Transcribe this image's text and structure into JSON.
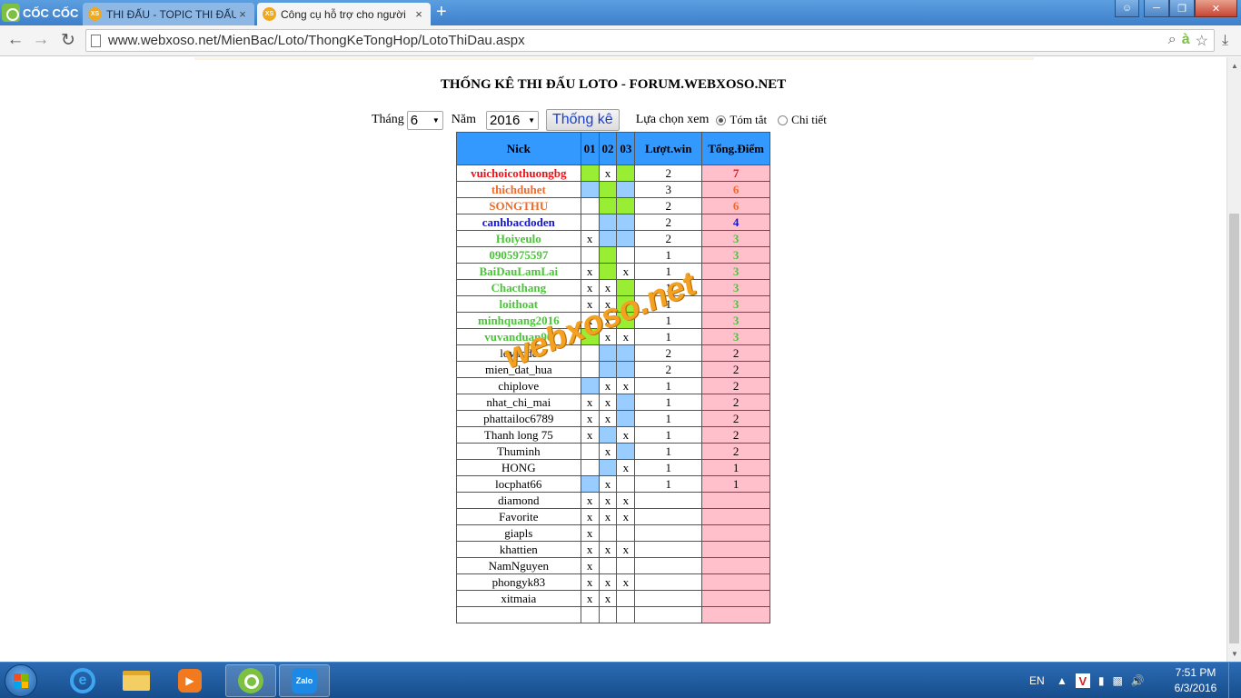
{
  "browser": {
    "brand": "CỐC CỐC",
    "tabs": [
      {
        "title": "THI ĐẤU - TOPIC THI ĐẤU",
        "favicon": "XS",
        "active": false
      },
      {
        "title": "Công cụ hỗ trợ cho người",
        "favicon": "XS",
        "active": true
      }
    ],
    "new_tab": "+",
    "url": "www.webxoso.net/MienBac/Loto/ThongKeTongHop/LotoThiDau.aspx"
  },
  "page": {
    "title": "THỐNG KÊ THI ĐẤU LOTO - FORUM.WEBXOSO.NET",
    "controls": {
      "month_label": "Tháng",
      "month_value": "6",
      "year_label": "Năm",
      "year_value": "2016",
      "submit_label": "Thống kê",
      "view_label": "Lựa chọn xem",
      "option_summary": "Tóm tắt",
      "option_detail": "Chi tiết"
    },
    "table": {
      "headers": [
        "Nick",
        "01",
        "02",
        "03",
        "Lượt.win",
        "Tổng.Điểm"
      ],
      "rows": [
        {
          "nick": "vuichoicothuongbg",
          "color": "#e8141a",
          "days": [
            "G",
            "x",
            "G"
          ],
          "wins": "2",
          "points": "7"
        },
        {
          "nick": "thichduhet",
          "color": "#f06a2a",
          "days": [
            "B",
            "G",
            "B"
          ],
          "wins": "3",
          "points": "6"
        },
        {
          "nick": "SONGTHU",
          "color": "#f06a2a",
          "days": [
            "",
            "G",
            "G"
          ],
          "wins": "2",
          "points": "6"
        },
        {
          "nick": "canhbacdoden",
          "color": "#1414cc",
          "days": [
            "",
            "B",
            "B"
          ],
          "wins": "2",
          "points": "4"
        },
        {
          "nick": "Hoiyeulo",
          "color": "#4cc43a",
          "days": [
            "x",
            "B",
            "B"
          ],
          "wins": "2",
          "points": "3"
        },
        {
          "nick": "0905975597",
          "color": "#4cc43a",
          "days": [
            "",
            "G",
            ""
          ],
          "wins": "1",
          "points": "3"
        },
        {
          "nick": "BaiDauLamLai",
          "color": "#4cc43a",
          "days": [
            "x",
            "G",
            "x"
          ],
          "wins": "1",
          "points": "3"
        },
        {
          "nick": "Chacthang",
          "color": "#4cc43a",
          "days": [
            "x",
            "x",
            "G"
          ],
          "wins": "1",
          "points": "3"
        },
        {
          "nick": "loithoat",
          "color": "#4cc43a",
          "days": [
            "x",
            "x",
            "G"
          ],
          "wins": "1",
          "points": "3"
        },
        {
          "nick": "minhquang2016",
          "color": "#4cc43a",
          "days": [
            "x",
            "x",
            "G"
          ],
          "wins": "1",
          "points": "3"
        },
        {
          "nick": "vuvanduan90",
          "color": "#4cc43a",
          "days": [
            "G",
            "x",
            "x"
          ],
          "wins": "1",
          "points": "3"
        },
        {
          "nick": "lovande",
          "color": "#000000",
          "days": [
            "",
            "B",
            "B"
          ],
          "wins": "2",
          "points": "2"
        },
        {
          "nick": "mien_dat_hua",
          "color": "#000000",
          "days": [
            "",
            "B",
            "B"
          ],
          "wins": "2",
          "points": "2"
        },
        {
          "nick": "chiplove",
          "color": "#000000",
          "days": [
            "B",
            "x",
            "x"
          ],
          "wins": "1",
          "points": "2"
        },
        {
          "nick": "nhat_chi_mai",
          "color": "#000000",
          "days": [
            "x",
            "x",
            "B"
          ],
          "wins": "1",
          "points": "2"
        },
        {
          "nick": "phattailoc6789",
          "color": "#000000",
          "days": [
            "x",
            "x",
            "B"
          ],
          "wins": "1",
          "points": "2"
        },
        {
          "nick": "Thanh long 75",
          "color": "#000000",
          "days": [
            "x",
            "B",
            "x"
          ],
          "wins": "1",
          "points": "2"
        },
        {
          "nick": "Thuminh",
          "color": "#000000",
          "days": [
            "",
            "x",
            "B"
          ],
          "wins": "1",
          "points": "2"
        },
        {
          "nick": "HONG",
          "color": "#000000",
          "days": [
            "",
            "B",
            "x"
          ],
          "wins": "1",
          "points": "1"
        },
        {
          "nick": "locphat66",
          "color": "#000000",
          "days": [
            "B",
            "x",
            ""
          ],
          "wins": "1",
          "points": "1"
        },
        {
          "nick": "diamond",
          "color": "#000000",
          "days": [
            "x",
            "x",
            "x"
          ],
          "wins": "",
          "points": ""
        },
        {
          "nick": "Favorite",
          "color": "#000000",
          "days": [
            "x",
            "x",
            "x"
          ],
          "wins": "",
          "points": ""
        },
        {
          "nick": "giapls",
          "color": "#000000",
          "days": [
            "x",
            "",
            ""
          ],
          "wins": "",
          "points": ""
        },
        {
          "nick": "khattien",
          "color": "#000000",
          "days": [
            "x",
            "x",
            "x"
          ],
          "wins": "",
          "points": ""
        },
        {
          "nick": "NamNguyen",
          "color": "#000000",
          "days": [
            "x",
            "",
            ""
          ],
          "wins": "",
          "points": ""
        },
        {
          "nick": "phongyk83",
          "color": "#000000",
          "days": [
            "x",
            "x",
            "x"
          ],
          "wins": "",
          "points": ""
        },
        {
          "nick": "xitmaia",
          "color": "#000000",
          "days": [
            "x",
            "x",
            ""
          ],
          "wins": "",
          "points": ""
        },
        {
          "nick": "",
          "color": "#000000",
          "days": [
            "",
            "",
            ""
          ],
          "wins": "",
          "points": ""
        }
      ],
      "cell_colors": {
        "G": "#99ee33",
        "B": "#99ccff",
        "points_bg": "#ffc0cb",
        "header_bg": "#3399ff"
      }
    },
    "watermark": "webxoso.net"
  },
  "taskbar": {
    "apps": [
      "internet-explorer-icon",
      "file-explorer-icon",
      "media-player-icon",
      "coccoc-browser-icon",
      "zalo-icon"
    ],
    "zalo_label": "Zalo",
    "language": "EN",
    "time": "7:51 PM",
    "date": "6/3/2016"
  }
}
